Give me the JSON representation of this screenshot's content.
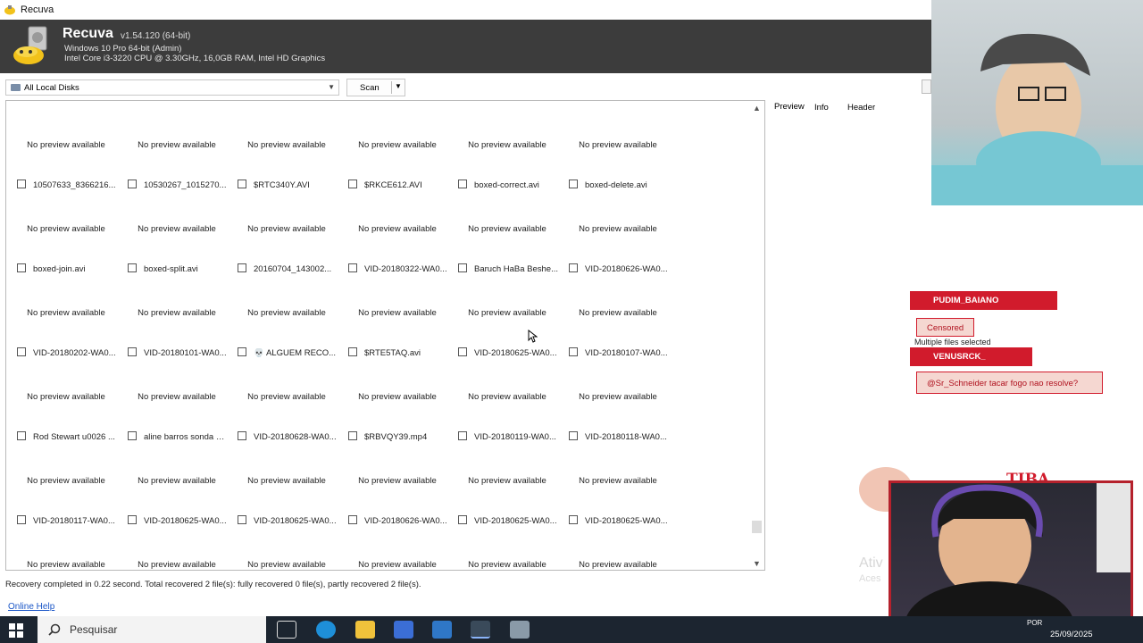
{
  "window": {
    "title": "Recuva"
  },
  "header": {
    "app_name": "Recuva",
    "version": "v1.54.120 (64-bit)",
    "os": "Windows 10 Pro 64-bit (Admin)",
    "hardware": "Intel Core i3-3220 CPU @ 3.30GHz, 16,0GB RAM, Intel HD Graphics"
  },
  "toolbar": {
    "drive_selected": "All Local Disks",
    "scan_label": "Scan"
  },
  "tabs": [
    "Preview",
    "Info",
    "Header"
  ],
  "gallery": {
    "no_preview_text": "No preview available",
    "rows": [
      [
        "10507633_8366216...",
        "10530267_1015270...",
        "$RTC340Y.AVI",
        "$RKCE612.AVI",
        "boxed-correct.avi",
        "boxed-delete.avi"
      ],
      [
        "boxed-join.avi",
        "boxed-split.avi",
        "20160704_143002...",
        "VID-20180322-WA0...",
        "Baruch HaBa Beshe...",
        "VID-20180626-WA0..."
      ],
      [
        "VID-20180202-WA0...",
        "VID-20180101-WA0...",
        "💀 ALGUEM RECO...",
        "$RTE5TAQ.avi",
        "VID-20180625-WA0...",
        "VID-20180107-WA0..."
      ],
      [
        "Rod Stewart u0026 ...",
        "aline barros sonda m...",
        "VID-20180628-WA0...",
        "$RBVQY39.mp4",
        "VID-20180119-WA0...",
        "VID-20180118-WA0..."
      ],
      [
        "VID-20180117-WA0...",
        "VID-20180625-WA0...",
        "VID-20180625-WA0...",
        "VID-20180626-WA0...",
        "VID-20180625-WA0...",
        "VID-20180625-WA0..."
      ]
    ]
  },
  "status": {
    "message": "Recovery completed in 0.22 second. Total recovered 2 file(s): fully recovered 0 file(s), partly recovered 2 file(s).",
    "online_help": "Online Help"
  },
  "overlay": {
    "chat_user1": "PUDIM_BAIANO",
    "chat_msg1": "Censored",
    "multi_selected": "Multiple files selected",
    "chat_user2": "VENUSRCK_",
    "chat_msg2": "@Sr_Schneider tacar fogo nao resolve?",
    "cam_label": "TIBA",
    "watermark": "Ativ",
    "watermark2": "Aces"
  },
  "taskbar": {
    "search_placeholder": "Pesquisar",
    "language": "POR",
    "date": "25/09/2025"
  },
  "colors": {
    "header_bg": "#3c3c3c",
    "accent_red": "#d11b2c",
    "link": "#1a56c7",
    "taskbar": "#1c2530"
  }
}
